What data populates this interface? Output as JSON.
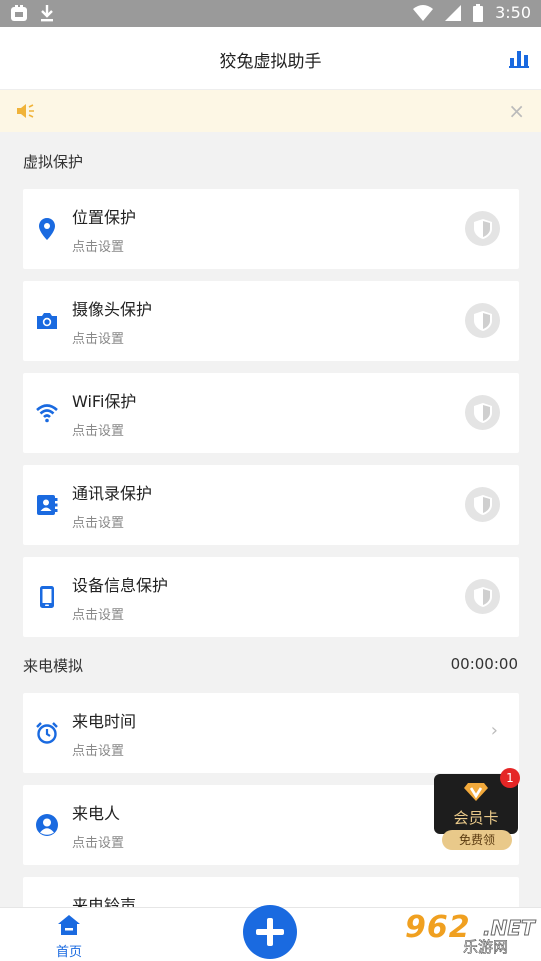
{
  "status_bar": {
    "time": "3:50"
  },
  "app_bar": {
    "title": "狡兔虚拟助手"
  },
  "notice": {
    "close_label": "×"
  },
  "sections": {
    "virtual_protect": {
      "title": "虚拟保护"
    },
    "call_sim": {
      "title": "来电模拟",
      "timer": "00:00:00"
    }
  },
  "protect_items": [
    {
      "label": "位置保护",
      "sub": "点击设置",
      "icon": "location-pin-icon"
    },
    {
      "label": "摄像头保护",
      "sub": "点击设置",
      "icon": "camera-icon"
    },
    {
      "label": "WiFi保护",
      "sub": "点击设置",
      "icon": "wifi-icon"
    },
    {
      "label": "通讯录保护",
      "sub": "点击设置",
      "icon": "contacts-icon"
    },
    {
      "label": "设备信息保护",
      "sub": "点击设置",
      "icon": "phone-icon"
    }
  ],
  "call_items": [
    {
      "label": "来电时间",
      "sub": "点击设置",
      "icon": "alarm-clock-icon"
    },
    {
      "label": "来电人",
      "sub": "点击设置",
      "icon": "person-icon"
    },
    {
      "label": "来电铃声",
      "icon": "ringtone-icon"
    }
  ],
  "vip_card": {
    "label": "会员卡",
    "button": "免费领",
    "badge": "1"
  },
  "tab_bar": {
    "home_label": "首页"
  },
  "watermark": {
    "number": "962",
    "suffix": ".NET",
    "site": "乐游网"
  },
  "colors": {
    "accent": "#1a6ae0",
    "notice_bg": "#fdf7e5"
  }
}
